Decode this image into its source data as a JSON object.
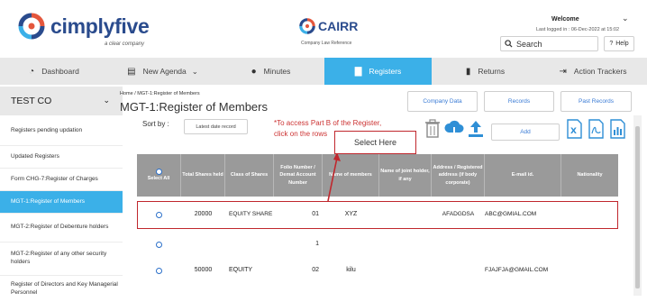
{
  "header": {
    "brand": "cimplyfive",
    "brand_sub": "a clear company",
    "product": "CAIRR",
    "product_sub": "Company Law Reference",
    "welcome": "Welcome",
    "last_logged": "Last logged in : 06-Dec-2022 at 15:02",
    "search_placeholder": "Search",
    "help_label": "Help"
  },
  "nav": {
    "items": [
      {
        "label": "Dashboard",
        "icon": "gauge-icon"
      },
      {
        "label": "New Agenda",
        "icon": "list-icon"
      },
      {
        "label": "Minutes",
        "icon": "clock-icon"
      },
      {
        "label": "Registers",
        "icon": "folder-icon"
      },
      {
        "label": "Returns",
        "icon": "document-icon"
      },
      {
        "label": "Action Trackers",
        "icon": "export-icon"
      }
    ]
  },
  "company": {
    "name": "TEST CO"
  },
  "breadcrumb": {
    "home": "Home",
    "current": "MGT-1:Register of Members"
  },
  "page_title": "MGT-1:Register of Members",
  "top_buttons": {
    "company_data": "Company Data",
    "records": "Records",
    "past_records": "Past Records"
  },
  "sidebar": {
    "items": [
      "Registers pending updation",
      "Updated Registers",
      "Form CHG-7:Register of Charges",
      "MGT-1:Register of Members",
      "MGT-2:Register of Debenture holders",
      "MGT-2:Register of any other security holders",
      "Register of Directors and Key Managerial Personnel"
    ]
  },
  "sort": {
    "label": "Sort by :",
    "select_value": "Latest date record"
  },
  "note": "*To access Part B of the Register, click on the rows",
  "add_label": "Add",
  "callout": "Select Here",
  "colors": {
    "accent": "#3bb0e8",
    "highlight": "#c0272d",
    "header_gray": "#9a9a9a"
  },
  "table": {
    "headers": [
      "Select All",
      "Total Shares held",
      "Class of Shares",
      "Folio Number / Demat Account Number",
      "Name of members",
      "Name of joint holder, if any",
      "Address / Registered address (if body corporate)",
      "E-mail id.",
      "Nationality"
    ],
    "rows": [
      {
        "shares": "20000",
        "class": "EQUITY SHARE",
        "folio": "01",
        "name": "XYZ",
        "joint": "",
        "address": "AFADGDSA",
        "email": "ABC@GMIAL.COM",
        "nationality": ""
      },
      {
        "shares": "",
        "class": "",
        "folio": "1",
        "name": "",
        "joint": "",
        "address": "",
        "email": "",
        "nationality": ""
      },
      {
        "shares": "50000",
        "class": "EQUITY",
        "folio": "02",
        "name": "kilu",
        "joint": "",
        "address": "",
        "email": "FJAJFJA@GMAIL.COM",
        "nationality": ""
      }
    ]
  }
}
